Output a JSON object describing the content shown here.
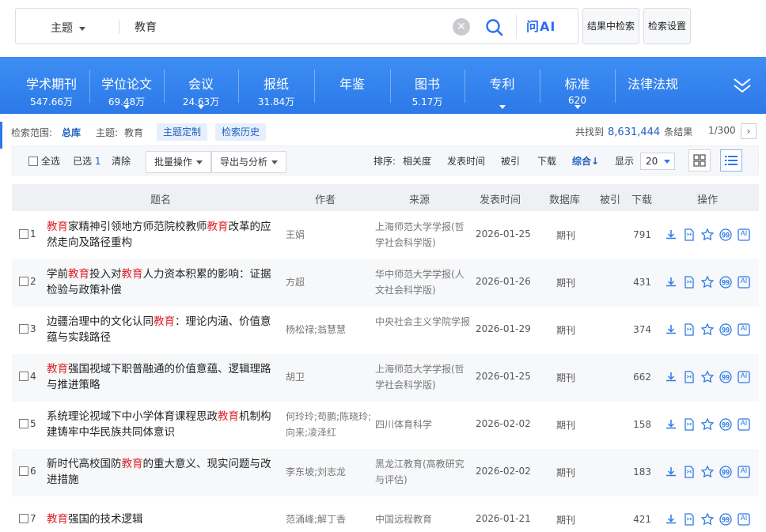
{
  "search": {
    "scope": "主题",
    "query": "教育",
    "clear_glyph": "✕",
    "ai_label": "问AI",
    "in_results_label": "结果中检索",
    "settings_label": "检索设置"
  },
  "databases": [
    {
      "name": "学术期刊",
      "count": "547.66万"
    },
    {
      "name": "学位论文",
      "count": "69.48万"
    },
    {
      "name": "会议",
      "count": "24.63万"
    },
    {
      "name": "报纸",
      "count": "31.84万"
    },
    {
      "name": "年鉴",
      "count": ""
    },
    {
      "name": "图书",
      "count": "5.17万"
    },
    {
      "name": "专利",
      "count": ""
    },
    {
      "name": "标准",
      "count": "620"
    },
    {
      "name": "法律法规",
      "count": ""
    }
  ],
  "scope_row": {
    "range_label": "检索范围:",
    "range_value": "总库",
    "topic_label": "主题:",
    "topic_value": "教育",
    "custom_topic": "主题定制",
    "history": "检索历史",
    "found_prefix": "共找到",
    "found_count": "8,631,444",
    "found_suffix": "条结果",
    "page": "1/300",
    "next_glyph": "›"
  },
  "toolbar": {
    "select_all": "全选",
    "selected_label": "已选",
    "selected_count": "1",
    "clear": "清除",
    "batch": "批量操作",
    "export": "导出与分析",
    "sort_label": "排序:",
    "sort_relevance": "相关度",
    "sort_date": "发表时间",
    "sort_cited": "被引",
    "sort_download": "下载",
    "sort_combined": "综合↓",
    "display_label": "显示",
    "display_value": "20"
  },
  "columns": {
    "title": "题名",
    "author": "作者",
    "source": "来源",
    "date": "发表时间",
    "database": "数据库",
    "cited": "被引",
    "download": "下载",
    "ops": "操作"
  },
  "rows": [
    {
      "idx": "1",
      "title_parts": [
        [
          "教育",
          true
        ],
        [
          "家精神引领地方师范院校教师",
          false
        ],
        [
          "教育",
          true
        ],
        [
          "改革的应然走向及路径重构",
          false
        ]
      ],
      "author": "王娟",
      "source": "上海师范大学学报(哲学社会科学版)",
      "date": "2026-01-25",
      "db": "期刊",
      "downloads": "791"
    },
    {
      "idx": "2",
      "title_parts": [
        [
          "学前",
          false
        ],
        [
          "教育",
          true
        ],
        [
          "投入对",
          false
        ],
        [
          "教育",
          true
        ],
        [
          "人力资本积累的影响：证据检验与政策补偿",
          false
        ]
      ],
      "author": "方超",
      "source": "华中师范大学学报(人文社会科学版)",
      "date": "2026-01-26",
      "db": "期刊",
      "downloads": "431"
    },
    {
      "idx": "3",
      "title_parts": [
        [
          "边疆治理中的文化认同",
          false
        ],
        [
          "教育",
          true
        ],
        [
          "：理论内涵、价值意蕴与实践路径",
          false
        ]
      ],
      "author": "杨松禄;翁慧慧",
      "source": "中央社会主义学院学报",
      "date": "2026-01-29",
      "db": "期刊",
      "downloads": "374"
    },
    {
      "idx": "4",
      "title_parts": [
        [
          "教育",
          true
        ],
        [
          "强国视域下职普融通的价值意蕴、逻辑理路与推进策略",
          false
        ]
      ],
      "author": "胡卫",
      "source": "上海师范大学学报(哲学社会科学版)",
      "date": "2026-01-25",
      "db": "期刊",
      "downloads": "662"
    },
    {
      "idx": "5",
      "title_parts": [
        [
          "系统理论视域下中小学体育课程思政",
          false
        ],
        [
          "教育",
          true
        ],
        [
          "机制构建铸牢中华民族共同体意识",
          false
        ]
      ],
      "author": "何玲玲;苟鹏;陈晓玲;向来;凌泽红",
      "source": "四川体育科学",
      "date": "2026-02-02",
      "db": "期刊",
      "downloads": "158"
    },
    {
      "idx": "6",
      "title_parts": [
        [
          "新时代高校国防",
          false
        ],
        [
          "教育",
          true
        ],
        [
          "的重大意义、现实问题与改进措施",
          false
        ]
      ],
      "author": "李东坡;刘志龙",
      "source": "黑龙江教育(高教研究与评估)",
      "date": "2026-02-02",
      "db": "期刊",
      "downloads": "183"
    },
    {
      "idx": "7",
      "title_parts": [
        [
          "教育",
          true
        ],
        [
          "强国的技术逻辑",
          false
        ]
      ],
      "author": "范涌峰;解丁香",
      "source": "中国远程教育",
      "date": "2026-01-21",
      "db": "期刊",
      "downloads": "421"
    }
  ],
  "row_ops": [
    "download-icon",
    "html-read-icon",
    "favorite-star-icon",
    "cite-icon",
    "ai-icon"
  ],
  "ai_op_label": "AI",
  "colors": {
    "accent": "#2c79e8",
    "highlight": "#e0222a",
    "link": "#1f5fbf"
  }
}
